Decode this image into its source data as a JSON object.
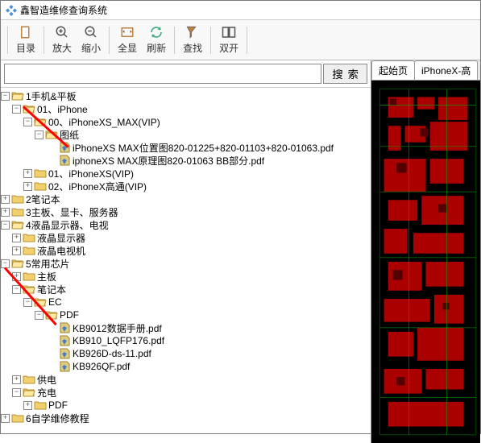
{
  "app": {
    "title": "鑫智造维修查询系统"
  },
  "toolbar": {
    "catalog": "目录",
    "zoom_in": "放大",
    "zoom_out": "缩小",
    "fit": "全显",
    "refresh": "刷新",
    "search": "查找",
    "dual": "双开"
  },
  "search": {
    "placeholder": "",
    "button": "搜索"
  },
  "tree": [
    {
      "d": 0,
      "t": "-",
      "k": "f",
      "label": "1手机&平板"
    },
    {
      "d": 1,
      "t": "-",
      "k": "f",
      "label": "01、iPhone"
    },
    {
      "d": 2,
      "t": "-",
      "k": "f",
      "label": "00、iPhoneXS_MAX(VIP)"
    },
    {
      "d": 3,
      "t": "-",
      "k": "f",
      "label": "图纸"
    },
    {
      "d": 4,
      "t": " ",
      "k": "p",
      "label": "iPhoneXS MAX位置图820-01225+820-01103+820-01063.pdf"
    },
    {
      "d": 4,
      "t": " ",
      "k": "p",
      "label": "iphoneXS MAX原理图820-01063 BB部分.pdf"
    },
    {
      "d": 2,
      "t": "+",
      "k": "f",
      "label": "01、iPhoneXS(VIP)"
    },
    {
      "d": 2,
      "t": "+",
      "k": "f",
      "label": "02、iPhoneX高通(VIP)"
    },
    {
      "d": 0,
      "t": "+",
      "k": "f",
      "label": "2笔记本"
    },
    {
      "d": 0,
      "t": "+",
      "k": "f",
      "label": "3主板、显卡、服务器"
    },
    {
      "d": 0,
      "t": "-",
      "k": "f",
      "label": "4液晶显示器、电视"
    },
    {
      "d": 1,
      "t": "+",
      "k": "f",
      "label": "液晶显示器"
    },
    {
      "d": 1,
      "t": "+",
      "k": "f",
      "label": "液晶电视机"
    },
    {
      "d": 0,
      "t": "-",
      "k": "f",
      "label": "5常用芯片"
    },
    {
      "d": 1,
      "t": "+",
      "k": "f",
      "label": "主板"
    },
    {
      "d": 1,
      "t": "-",
      "k": "f",
      "label": "笔记本"
    },
    {
      "d": 2,
      "t": "-",
      "k": "f",
      "label": "EC"
    },
    {
      "d": 3,
      "t": "-",
      "k": "f",
      "label": "PDF"
    },
    {
      "d": 4,
      "t": " ",
      "k": "p",
      "label": "KB9012数据手册.pdf"
    },
    {
      "d": 4,
      "t": " ",
      "k": "p",
      "label": "KB910_LQFP176.pdf"
    },
    {
      "d": 4,
      "t": " ",
      "k": "p",
      "label": "KB926D-ds-11.pdf"
    },
    {
      "d": 4,
      "t": " ",
      "k": "p",
      "label": "KB926QF.pdf"
    },
    {
      "d": 1,
      "t": "+",
      "k": "f",
      "label": "供电"
    },
    {
      "d": 1,
      "t": "-",
      "k": "f",
      "label": "充电"
    },
    {
      "d": 2,
      "t": "+",
      "k": "f",
      "label": "PDF"
    },
    {
      "d": 0,
      "t": "+",
      "k": "f",
      "label": "6自学维修教程"
    }
  ],
  "tabs": {
    "start": "起始页",
    "doc": "iPhoneX-高"
  },
  "icons": {
    "folder_open": "folder-open-icon",
    "folder_closed": "folder-closed-icon",
    "pdf": "pdf-icon"
  }
}
